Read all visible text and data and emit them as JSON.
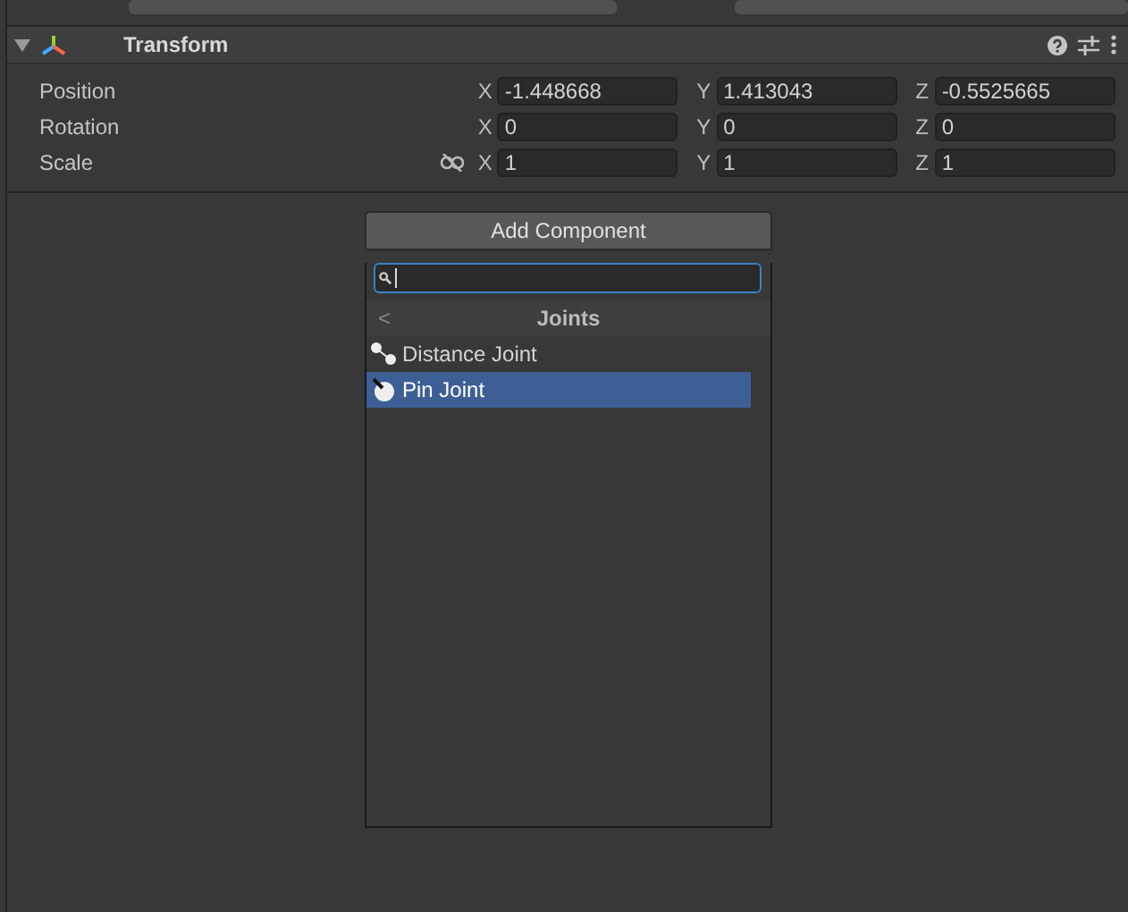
{
  "component": {
    "title": "Transform",
    "expanded": true
  },
  "rows": [
    {
      "label": "Position",
      "fields": [
        {
          "axis": "X",
          "value": "-1.448668"
        },
        {
          "axis": "Y",
          "value": "1.413043"
        },
        {
          "axis": "Z",
          "value": "-0.5525665"
        }
      ]
    },
    {
      "label": "Rotation",
      "fields": [
        {
          "axis": "X",
          "value": "0"
        },
        {
          "axis": "Y",
          "value": "0"
        },
        {
          "axis": "Z",
          "value": "0"
        }
      ]
    },
    {
      "label": "Scale",
      "linked": false,
      "fields": [
        {
          "axis": "X",
          "value": "1"
        },
        {
          "axis": "Y",
          "value": "1"
        },
        {
          "axis": "Z",
          "value": "1"
        }
      ]
    }
  ],
  "add_component": {
    "button": "Add Component",
    "back": "<",
    "category": "Joints",
    "items": [
      {
        "label": "Distance Joint",
        "kind": "distance",
        "selected": false
      },
      {
        "label": "Pin Joint",
        "kind": "pin",
        "selected": true
      }
    ]
  }
}
